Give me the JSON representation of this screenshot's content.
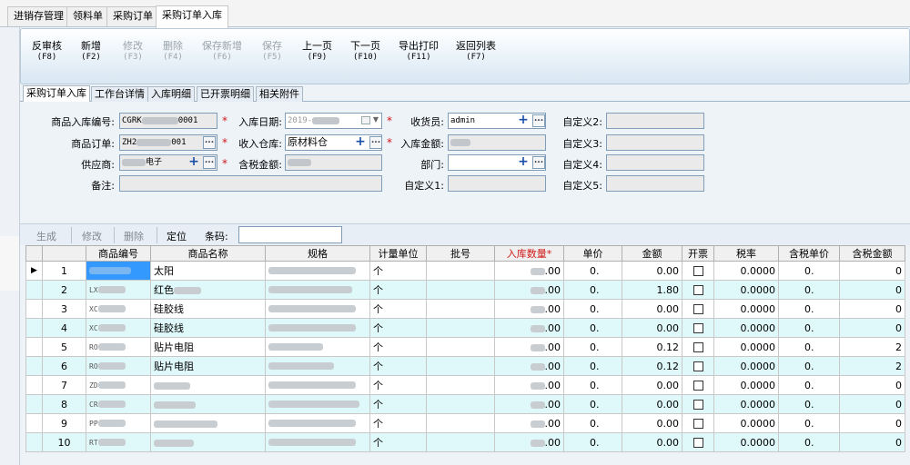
{
  "top_tabs": [
    "进销存管理",
    "领料单",
    "采购订单",
    "采购订单入库"
  ],
  "toolbar": [
    {
      "label": "反审核",
      "key": "(F8)",
      "enabled": true
    },
    {
      "label": "新增",
      "key": "(F2)",
      "enabled": true
    },
    {
      "label": "修改",
      "key": "(F3)",
      "enabled": false
    },
    {
      "label": "删除",
      "key": "(F4)",
      "enabled": false
    },
    {
      "label": "保存新增",
      "key": "(F6)",
      "enabled": false
    },
    {
      "label": "保存",
      "key": "(F5)",
      "enabled": false
    },
    {
      "label": "上一页",
      "key": "(F9)",
      "enabled": true
    },
    {
      "label": "下一页",
      "key": "(F10)",
      "enabled": true
    },
    {
      "label": "导出打印",
      "key": "(F11)",
      "enabled": true
    },
    {
      "label": "返回列表",
      "key": "(F7)",
      "enabled": true
    }
  ],
  "form_tabs": [
    "采购订单入库",
    "工作台详情",
    "入库明细",
    "已开票明细",
    "相关附件"
  ],
  "form": {
    "receipt_no_label": "商品入库编号:",
    "receipt_no_prefix": "CGRK",
    "receipt_no_suffix": "0001",
    "order_label": "商品订单:",
    "order_prefix": "ZH2",
    "order_suffix": "001",
    "supplier_label": "供应商:",
    "supplier_suffix": "电子",
    "remark_label": "备注:",
    "date_label": "入库日期:",
    "date_value": "2019-",
    "warehouse_label": "收入仓库:",
    "warehouse_value": "原材料仓",
    "tax_total_label": "含税金额:",
    "receiver_label": "收货员:",
    "receiver_value": "admin",
    "amount_label": "入库金额:",
    "dept_label": "部门:",
    "custom1_label": "自定义1:",
    "custom2_label": "自定义2:",
    "custom3_label": "自定义3:",
    "custom4_label": "自定义4:",
    "custom5_label": "自定义5:"
  },
  "detail_toolbar": {
    "generate": "生成",
    "modify": "修改",
    "delete": "删除",
    "locate": "定位",
    "barcode_label": "条码:"
  },
  "grid": {
    "headers": [
      "商品编号",
      "商品名称",
      "规格",
      "计量单位",
      "批号",
      "入库数量*",
      "单价",
      "金额",
      "开票",
      "税率",
      "含税单价",
      "含税金额"
    ],
    "rows": [
      {
        "seq": "1",
        "code": "",
        "name": "太阳",
        "spec": "",
        "unit": "个",
        "qty_tail": ".00",
        "price": "0.",
        "amount": "0.00",
        "rate": "0.0000",
        "tax_price": "0.",
        "tax_amount": "0"
      },
      {
        "seq": "2",
        "code": "LX",
        "name": "红色",
        "spec": "",
        "unit": "个",
        "qty_tail": ".00",
        "price": "0.",
        "amount": "1.80",
        "rate": "0.0000",
        "tax_price": "0.",
        "tax_amount": "0"
      },
      {
        "seq": "3",
        "code": "XC",
        "name": "硅胶线",
        "spec": "",
        "unit": "个",
        "qty_tail": ".00",
        "price": "0.",
        "amount": "0.00",
        "rate": "0.0000",
        "tax_price": "0.",
        "tax_amount": "0"
      },
      {
        "seq": "4",
        "code": "XC",
        "name": "硅胶线",
        "spec": "",
        "unit": "个",
        "qty_tail": ".00",
        "price": "0.",
        "amount": "0.00",
        "rate": "0.0000",
        "tax_price": "0.",
        "tax_amount": "0"
      },
      {
        "seq": "5",
        "code": "RO",
        "name": "贴片电阻",
        "spec": "",
        "unit": "个",
        "qty_tail": ".00",
        "price": "0.",
        "amount": "0.12",
        "rate": "0.0000",
        "tax_price": "0.",
        "tax_amount": "2"
      },
      {
        "seq": "6",
        "code": "RO",
        "name": "贴片电阻",
        "spec": "",
        "unit": "个",
        "qty_tail": ".00",
        "price": "0.",
        "amount": "0.12",
        "rate": "0.0000",
        "tax_price": "0.",
        "tax_amount": "2"
      },
      {
        "seq": "7",
        "code": "ZD",
        "name": "",
        "spec": "",
        "unit": "个",
        "qty_tail": ".00",
        "price": "0.",
        "amount": "0.00",
        "rate": "0.0000",
        "tax_price": "0.",
        "tax_amount": "0"
      },
      {
        "seq": "8",
        "code": "CR",
        "name": "",
        "spec": "",
        "unit": "个",
        "qty_tail": ".00",
        "price": "0.",
        "amount": "0.00",
        "rate": "0.0000",
        "tax_price": "0.",
        "tax_amount": "0"
      },
      {
        "seq": "9",
        "code": "PP",
        "name": "",
        "spec": "",
        "unit": "个",
        "qty_tail": ".00",
        "price": "0.",
        "amount": "0.00",
        "rate": "0.0000",
        "tax_price": "0.",
        "tax_amount": "0"
      },
      {
        "seq": "10",
        "code": "RT",
        "name": "",
        "spec": "",
        "unit": "个",
        "qty_tail": ".00",
        "price": "0.",
        "amount": "0.00",
        "rate": "0.0000",
        "tax_price": "0.",
        "tax_amount": "0"
      }
    ]
  }
}
